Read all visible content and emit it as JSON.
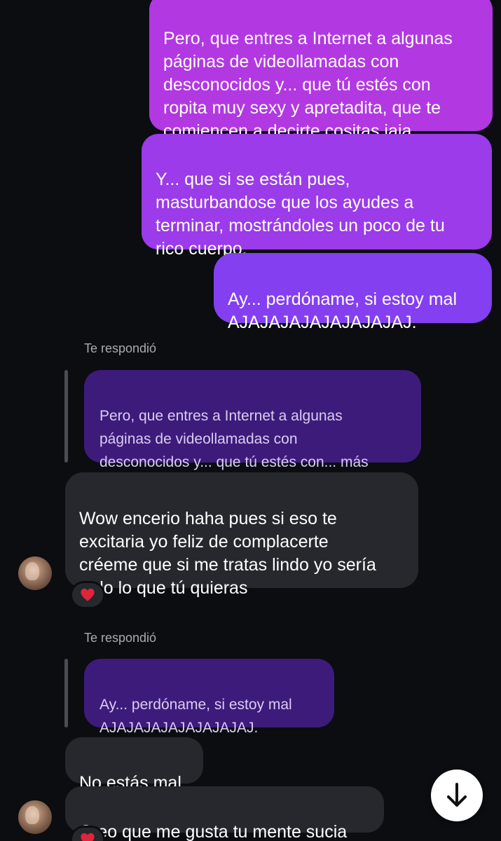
{
  "messages_out": [
    {
      "text": "Pero, que entres a Internet a algunas\npáginas de videollamadas con\ndesconocidos y... que tú estés con\nropita muy sexy y apretadita, que te\ncomiencen a decirte cositas jaja."
    },
    {
      "text": "Y... que si se están pues,\nmasturbandose que los ayudes a\nterminar, mostrándoles un poco de tu\nrico cuerpo."
    },
    {
      "text": "Ay... perdóname, si estoy mal\nAJAJAJAJAJAJAJAJAJ."
    }
  ],
  "replies": [
    {
      "label": "Te respondió",
      "quote": "Pero, que entres a Internet a algunas\npáginas de videollamadas con\ndesconocidos y... que tú estés con... más",
      "message": "Wow encerio haha pues si eso te\nexcitaria yo feliz de complacerte\ncréeme que si me tratas lindo yo sería\ntodo lo que tú quieras",
      "reaction": "heart"
    },
    {
      "label": "Te respondió",
      "quote": "Ay... perdóname, si estoy mal\nAJAJAJAJAJAJAJAJAJ."
    }
  ],
  "messages_in": [
    {
      "text": "No estás mal"
    },
    {
      "text": "Creo que me gusta tu mente sucia"
    }
  ],
  "icons": {
    "reaction": "heart-icon",
    "scroll": "arrow-down-icon",
    "avatar": "contact-avatar"
  },
  "colors": {
    "background": "#0b0d10",
    "incoming_bubble": "#26282d",
    "quote_bubble": "#3d1b7a",
    "outgoing_top": "#b43ae0",
    "outgoing_bottom": "#7f3ff0",
    "heart": "#e0243a"
  }
}
